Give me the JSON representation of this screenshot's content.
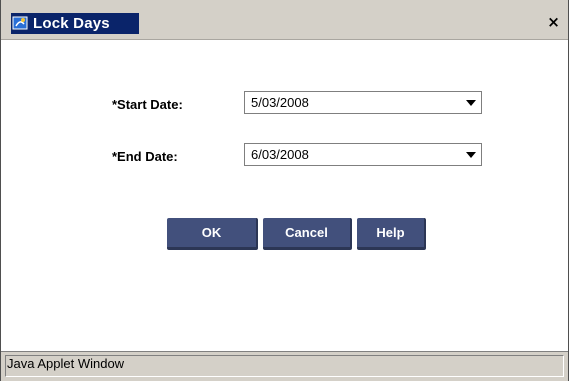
{
  "window": {
    "title": "Lock Days",
    "close_symbol": "×",
    "title_icon": "java-applet-icon"
  },
  "form": {
    "start_label": "*Start Date:",
    "start_value": "5/03/2008",
    "end_label": "*End Date:",
    "end_value": "6/03/2008"
  },
  "buttons": {
    "ok": "OK",
    "cancel": "Cancel",
    "help": "Help"
  },
  "status": {
    "text": "Java Applet Window"
  },
  "colors": {
    "title_bg": "#0a246a",
    "button_bg": "#42507c",
    "chrome": "#d4d0c8"
  }
}
